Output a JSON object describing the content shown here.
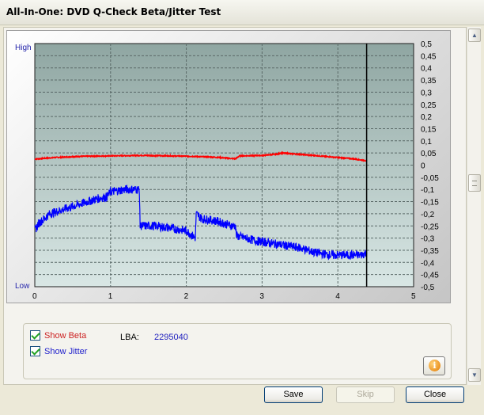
{
  "window": {
    "title": "All-In-One: DVD Q-Check Beta/Jitter Test"
  },
  "chart_data": {
    "type": "line",
    "x_ticks": [
      "0",
      "1",
      "2",
      "3",
      "4",
      "5"
    ],
    "xlim": [
      0,
      5
    ],
    "left_axis": {
      "top_label": "High",
      "bottom_label": "Low"
    },
    "right_axis": {
      "ylim": [
        -0.5,
        0.5
      ],
      "tick_labels": [
        "0,5",
        "0,45",
        "0,4",
        "0,35",
        "0,3",
        "0,25",
        "0,2",
        "0,15",
        "0,1",
        "0,05",
        "0",
        "-0,05",
        "-0,1",
        "-0,15",
        "-0,2",
        "-0,25",
        "-0,3",
        "-0,35",
        "-0,4",
        "-0,45",
        "-0,5"
      ]
    },
    "marker_x": 4.38,
    "grid": true,
    "series": [
      {
        "color": "#ff0000",
        "x": [
          0,
          0.3,
          0.6,
          1.0,
          1.4,
          1.8,
          2.1,
          2.4,
          2.65,
          2.7,
          3.0,
          3.2,
          3.25,
          3.6,
          3.9,
          4.2,
          4.38
        ],
        "y": [
          0.025,
          0.032,
          0.036,
          0.038,
          0.04,
          0.038,
          0.036,
          0.032,
          0.026,
          0.038,
          0.04,
          0.045,
          0.05,
          0.042,
          0.034,
          0.026,
          0.018
        ]
      },
      {
        "color": "#0000ff",
        "x": [
          0,
          0.05,
          0.2,
          0.4,
          0.6,
          0.8,
          0.95,
          1.0,
          1.2,
          1.38,
          1.39,
          1.6,
          1.8,
          2.0,
          2.12,
          2.13,
          2.2,
          2.4,
          2.6,
          2.65,
          2.66,
          2.9,
          3.1,
          3.3,
          3.5,
          3.7,
          3.9,
          4.1,
          4.3,
          4.38
        ],
        "y": [
          -0.27,
          -0.24,
          -0.2,
          -0.18,
          -0.16,
          -0.14,
          -0.13,
          -0.11,
          -0.1,
          -0.1,
          -0.25,
          -0.25,
          -0.26,
          -0.27,
          -0.3,
          -0.2,
          -0.22,
          -0.23,
          -0.25,
          -0.25,
          -0.29,
          -0.31,
          -0.32,
          -0.33,
          -0.34,
          -0.36,
          -0.37,
          -0.37,
          -0.37,
          -0.36
        ]
      }
    ]
  },
  "options": {
    "show_beta": {
      "label": "Show Beta",
      "color": "#cc2222",
      "checked": true
    },
    "show_jitter": {
      "label": "Show Jitter",
      "color": "#2222cc",
      "checked": true
    },
    "lba_label": "LBA:",
    "lba_value": "2295040"
  },
  "buttons": {
    "save": "Save",
    "skip": "Skip",
    "close": "Close"
  },
  "icons": {
    "info": "info-icon",
    "scroll_up": "scroll-up-icon",
    "scroll_down": "scroll-down-icon"
  }
}
